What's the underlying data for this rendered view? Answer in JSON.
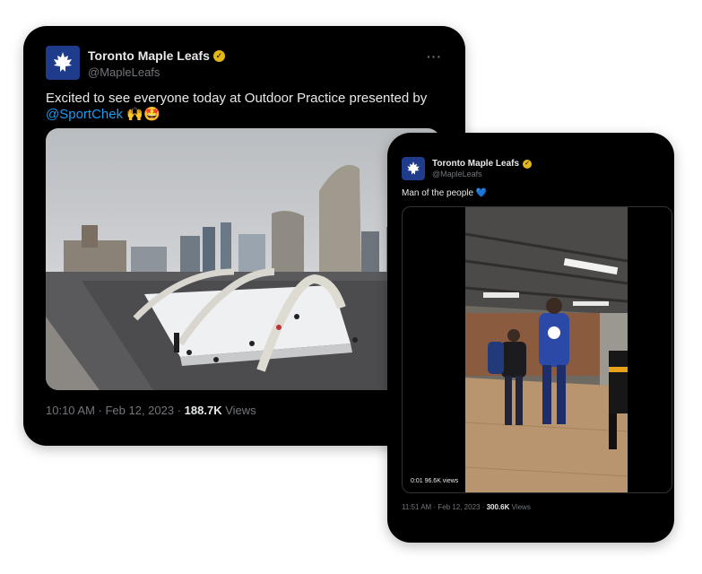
{
  "tweets": [
    {
      "author_name": "Toronto Maple Leafs",
      "handle": "@MapleLeafs",
      "verified_color": "#e2b719",
      "text": "Excited to see everyone today at Outdoor Practice presented by",
      "mention": "@SportChek",
      "emoji": "🙌🤩",
      "time": "10:10 AM · Feb 12, 2023 ·",
      "views_count": "188.7K",
      "views_label": "Views",
      "media": "photo of an outdoor ice rink under arches in front of city towers"
    },
    {
      "author_name": "Toronto Maple Leafs",
      "handle": "@MapleLeafs",
      "verified_color": "#e2b719",
      "text": "Man of the people",
      "emoji": "💙",
      "video_badge": "0:01  96.6K views",
      "time": "11:51 AM · Feb 12, 2023 ·",
      "views_count": "300.6K",
      "views_label": "Views"
    }
  ],
  "icons": {
    "more": "more-options-icon",
    "logo": "maple-leaf-logo-icon",
    "verified": "verified-badge-icon"
  }
}
